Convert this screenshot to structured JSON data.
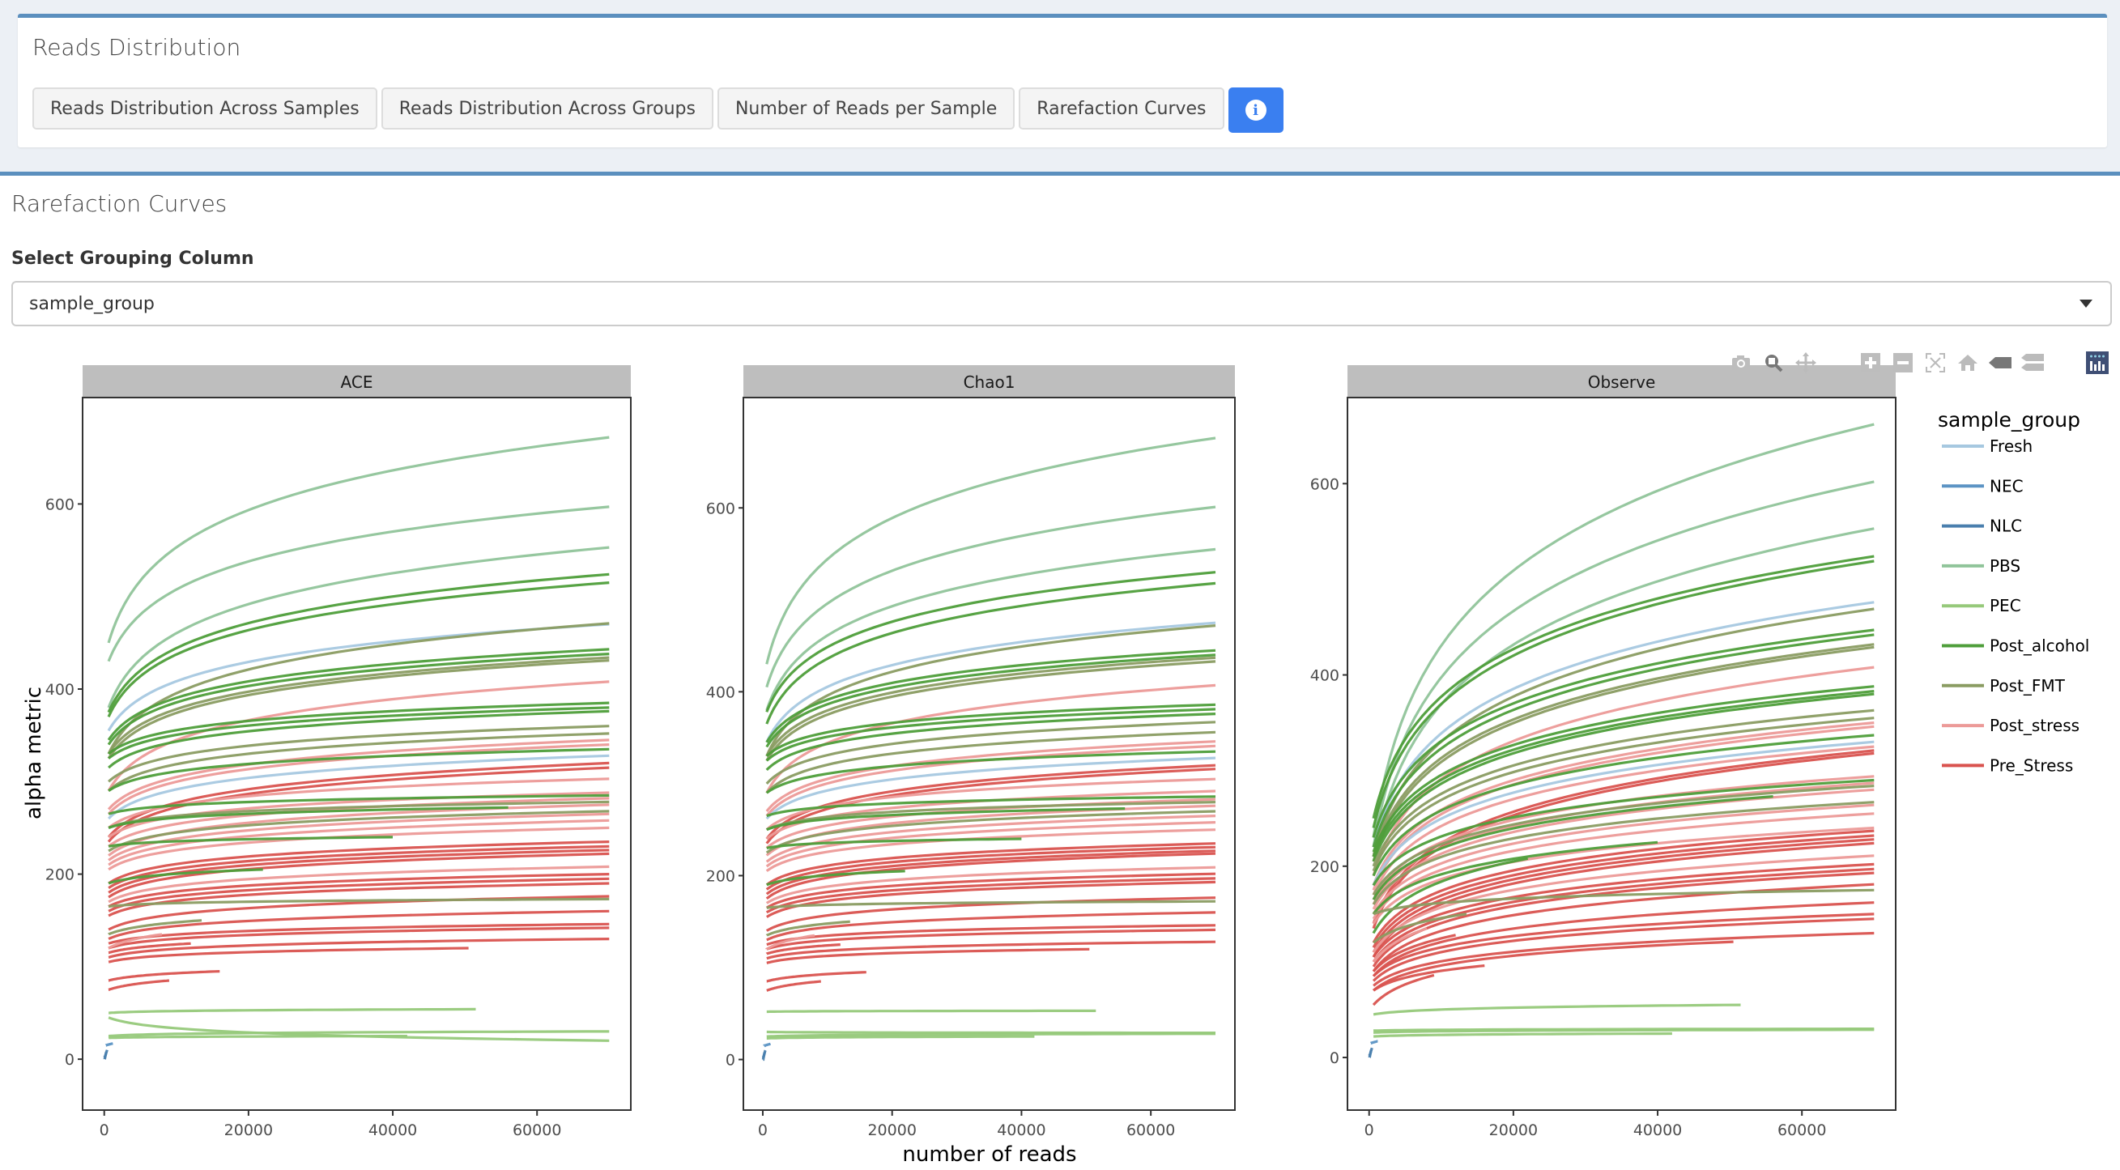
{
  "top": {
    "title": "Reads Distribution",
    "buttons": [
      {
        "label": "Reads Distribution Across Samples"
      },
      {
        "label": "Reads Distribution Across Groups"
      },
      {
        "label": "Number of Reads per Sample"
      },
      {
        "label": "Rarefaction Curves"
      }
    ],
    "info_icon": "info-circle-icon",
    "info_color": "#3a7ff0"
  },
  "main": {
    "title": "Rarefaction Curves",
    "select_label": "Select Grouping Column",
    "select_value": "sample_group"
  },
  "modebar": [
    "camera-icon",
    "zoom-icon",
    "pan-icon",
    "zoom-in-icon",
    "zoom-out-icon",
    "autoscale-icon",
    "home-icon",
    "hover-closest-icon",
    "hover-compare-icon",
    "plotly-logo-icon"
  ],
  "chart_data": {
    "type": "line",
    "facets": [
      "ACE",
      "Chao1",
      "Observe"
    ],
    "xlabel": "number of reads",
    "ylabel": "alpha metric",
    "x_ticks": [
      0,
      20000,
      40000,
      60000
    ],
    "y_ticks": [
      0,
      200,
      400,
      600
    ],
    "xlim": [
      -3000,
      73000
    ],
    "legend_title": "sample_group",
    "legend_position": "right",
    "groups": [
      {
        "name": "Fresh",
        "color": "#a6c8e0"
      },
      {
        "name": "NEC",
        "color": "#5b93c4"
      },
      {
        "name": "NLC",
        "color": "#4a7fae"
      },
      {
        "name": "PBS",
        "color": "#90c49a"
      },
      {
        "name": "PEC",
        "color": "#96c97a"
      },
      {
        "name": "Post_alcohol",
        "color": "#4e9e3a"
      },
      {
        "name": "Post_FMT",
        "color": "#8a9c62"
      },
      {
        "name": "Post_stress",
        "color": "#ec9a98"
      },
      {
        "name": "Pre_Stress",
        "color": "#d9534f"
      }
    ],
    "panels": [
      {
        "name": "ACE",
        "ylim": [
          -55,
          715
        ]
      },
      {
        "name": "Chao1",
        "ylim": [
          -55,
          720
        ]
      },
      {
        "name": "Observe",
        "ylim": [
          -55,
          690
        ]
      }
    ],
    "samples": [
      {
        "group": "PBS",
        "xmax": 70000,
        "ACE": [
          450,
          672
        ],
        "Chao1": [
          430,
          676
        ],
        "Observe": [
          230,
          662
        ]
      },
      {
        "group": "PBS",
        "xmax": 70000,
        "ACE": [
          430,
          597
        ],
        "Chao1": [
          405,
          601
        ],
        "Observe": [
          220,
          602
        ]
      },
      {
        "group": "PBS",
        "xmax": 70000,
        "ACE": [
          380,
          553
        ],
        "Chao1": [
          380,
          555
        ],
        "Observe": [
          210,
          553
        ]
      },
      {
        "group": "Post_alcohol",
        "xmax": 70000,
        "ACE": [
          375,
          524
        ],
        "Chao1": [
          378,
          530
        ],
        "Observe": [
          250,
          524
        ]
      },
      {
        "group": "Post_alcohol",
        "xmax": 70000,
        "ACE": [
          370,
          515
        ],
        "Chao1": [
          365,
          518
        ],
        "Observe": [
          240,
          519
        ]
      },
      {
        "group": "Fresh",
        "xmax": 70000,
        "ACE": [
          355,
          470
        ],
        "Chao1": [
          345,
          475
        ],
        "Observe": [
          220,
          476
        ]
      },
      {
        "group": "Post_FMT",
        "xmax": 70000,
        "ACE": [
          330,
          471
        ],
        "Chao1": [
          330,
          472
        ],
        "Observe": [
          210,
          469
        ]
      },
      {
        "group": "Post_alcohol",
        "xmax": 70000,
        "ACE": [
          345,
          443
        ],
        "Chao1": [
          345,
          445
        ],
        "Observe": [
          230,
          447
        ]
      },
      {
        "group": "Post_alcohol",
        "xmax": 70000,
        "ACE": [
          340,
          438
        ],
        "Chao1": [
          340,
          440
        ],
        "Observe": [
          220,
          442
        ]
      },
      {
        "group": "Post_FMT",
        "xmax": 70000,
        "ACE": [
          330,
          434
        ],
        "Chao1": [
          330,
          437
        ],
        "Observe": [
          210,
          432
        ]
      },
      {
        "group": "Post_FMT",
        "xmax": 70000,
        "ACE": [
          325,
          431
        ],
        "Chao1": [
          325,
          433
        ],
        "Observe": [
          205,
          429
        ]
      },
      {
        "group": "Post_stress",
        "xmax": 70000,
        "ACE": [
          290,
          408
        ],
        "Chao1": [
          290,
          407
        ],
        "Observe": [
          190,
          408
        ]
      },
      {
        "group": "Post_alcohol",
        "xmax": 70000,
        "ACE": [
          330,
          385
        ],
        "Chao1": [
          330,
          386
        ],
        "Observe": [
          215,
          388
        ]
      },
      {
        "group": "Post_alcohol",
        "xmax": 70000,
        "ACE": [
          325,
          380
        ],
        "Chao1": [
          325,
          381
        ],
        "Observe": [
          210,
          383
        ]
      },
      {
        "group": "Post_alcohol",
        "xmax": 70000,
        "ACE": [
          315,
          376
        ],
        "Chao1": [
          315,
          376
        ],
        "Observe": [
          205,
          380
        ]
      },
      {
        "group": "Post_FMT",
        "xmax": 70000,
        "ACE": [
          300,
          360
        ],
        "Chao1": [
          300,
          367
        ],
        "Observe": [
          200,
          363
        ]
      },
      {
        "group": "Post_FMT",
        "xmax": 70000,
        "ACE": [
          290,
          352
        ],
        "Chao1": [
          290,
          356
        ],
        "Observe": [
          195,
          355
        ]
      },
      {
        "group": "Post_stress",
        "xmax": 70000,
        "ACE": [
          270,
          345
        ],
        "Chao1": [
          270,
          346
        ],
        "Observe": [
          180,
          350
        ]
      },
      {
        "group": "Post_stress",
        "xmax": 70000,
        "ACE": [
          265,
          340
        ],
        "Chao1": [
          265,
          341
        ],
        "Observe": [
          175,
          346
        ]
      },
      {
        "group": "Post_alcohol",
        "xmax": 70000,
        "ACE": [
          290,
          335
        ],
        "Chao1": [
          290,
          335
        ],
        "Observe": [
          190,
          337
        ]
      },
      {
        "group": "Fresh",
        "xmax": 70000,
        "ACE": [
          260,
          328
        ],
        "Chao1": [
          262,
          328
        ],
        "Observe": [
          180,
          330
        ]
      },
      {
        "group": "Pre_Stress",
        "xmax": 70000,
        "ACE": [
          240,
          320
        ],
        "Chao1": [
          240,
          320
        ],
        "Observe": [
          140,
          321
        ]
      },
      {
        "group": "Pre_Stress",
        "xmax": 70000,
        "ACE": [
          235,
          315
        ],
        "Chao1": [
          235,
          316
        ],
        "Observe": [
          135,
          318
        ]
      },
      {
        "group": "Post_stress",
        "xmax": 70000,
        "ACE": [
          250,
          303
        ],
        "Chao1": [
          250,
          305
        ],
        "Observe": [
          170,
          325
        ]
      },
      {
        "group": "Post_stress",
        "xmax": 70000,
        "ACE": [
          240,
          288
        ],
        "Chao1": [
          240,
          292
        ],
        "Observe": [
          165,
          294
        ]
      },
      {
        "group": "Post_alcohol",
        "xmax": 70000,
        "ACE": [
          265,
          285
        ],
        "Chao1": [
          265,
          286
        ],
        "Observe": [
          180,
          290
        ]
      },
      {
        "group": "Post_stress",
        "xmax": 70000,
        "ACE": [
          230,
          282
        ],
        "Chao1": [
          230,
          283
        ],
        "Observe": [
          160,
          287
        ]
      },
      {
        "group": "Post_FMT",
        "xmax": 70000,
        "ACE": [
          250,
          278
        ],
        "Chao1": [
          250,
          280
        ],
        "Observe": [
          170,
          284
        ]
      },
      {
        "group": "Post_stress",
        "xmax": 70000,
        "ACE": [
          220,
          275
        ],
        "Chao1": [
          222,
          276
        ],
        "Observe": [
          155,
          280
        ]
      },
      {
        "group": "Post_alcohol",
        "xmax": 56000,
        "ACE": [
          250,
          272
        ],
        "Chao1": [
          250,
          273
        ],
        "Observe": [
          165,
          273
        ]
      },
      {
        "group": "Post_FMT",
        "xmax": 70000,
        "ACE": [
          225,
          268
        ],
        "Chao1": [
          225,
          270
        ],
        "Observe": [
          160,
          267
        ]
      },
      {
        "group": "Post_stress",
        "xmax": 70000,
        "ACE": [
          215,
          265
        ],
        "Chao1": [
          215,
          265
        ],
        "Observe": [
          150,
          264
        ]
      },
      {
        "group": "Post_stress",
        "xmax": 70000,
        "ACE": [
          210,
          258
        ],
        "Chao1": [
          210,
          258
        ],
        "Observe": [
          145,
          255
        ]
      },
      {
        "group": "Post_stress",
        "xmax": 70000,
        "ACE": [
          205,
          250
        ],
        "Chao1": [
          205,
          250
        ],
        "Observe": [
          140,
          240
        ]
      },
      {
        "group": "Post_alcohol",
        "xmax": 40000,
        "ACE": [
          230,
          240
        ],
        "Chao1": [
          230,
          240
        ],
        "Observe": [
          150,
          225
        ]
      },
      {
        "group": "Pre_Stress",
        "xmax": 70000,
        "ACE": [
          190,
          235
        ],
        "Chao1": [
          190,
          235
        ],
        "Observe": [
          120,
          237
        ]
      },
      {
        "group": "Pre_Stress",
        "xmax": 70000,
        "ACE": [
          185,
          230
        ],
        "Chao1": [
          185,
          231
        ],
        "Observe": [
          115,
          232
        ]
      },
      {
        "group": "Pre_Stress",
        "xmax": 70000,
        "ACE": [
          180,
          226
        ],
        "Chao1": [
          180,
          227
        ],
        "Observe": [
          110,
          228
        ]
      },
      {
        "group": "Pre_Stress",
        "xmax": 70000,
        "ACE": [
          175,
          222
        ],
        "Chao1": [
          175,
          224
        ],
        "Observe": [
          105,
          224
        ]
      },
      {
        "group": "Post_alcohol",
        "xmax": 22000,
        "ACE": [
          190,
          205
        ],
        "Chao1": [
          190,
          205
        ],
        "Observe": [
          130,
          208
        ]
      },
      {
        "group": "Post_stress",
        "xmax": 70000,
        "ACE": [
          170,
          208
        ],
        "Chao1": [
          170,
          209
        ],
        "Observe": [
          110,
          211
        ]
      },
      {
        "group": "Pre_Stress",
        "xmax": 70000,
        "ACE": [
          165,
          200
        ],
        "Chao1": [
          165,
          202
        ],
        "Observe": [
          105,
          202
        ]
      },
      {
        "group": "Pre_Stress",
        "xmax": 70000,
        "ACE": [
          160,
          195
        ],
        "Chao1": [
          160,
          197
        ],
        "Observe": [
          100,
          197
        ]
      },
      {
        "group": "Pre_Stress",
        "xmax": 70000,
        "ACE": [
          155,
          190
        ],
        "Chao1": [
          155,
          193
        ],
        "Observe": [
          95,
          193
        ]
      },
      {
        "group": "Pre_Stress",
        "xmax": 70000,
        "ACE": [
          140,
          176
        ],
        "Chao1": [
          140,
          176
        ],
        "Observe": [
          90,
          181
        ]
      },
      {
        "group": "Post_FMT",
        "xmax": 70000,
        "ACE": [
          165,
          173
        ],
        "Chao1": [
          165,
          172
        ],
        "Observe": [
          150,
          175
        ]
      },
      {
        "group": "Pre_Stress",
        "xmax": 70000,
        "ACE": [
          130,
          160
        ],
        "Chao1": [
          130,
          160
        ],
        "Observe": [
          85,
          162
        ]
      },
      {
        "group": "Post_FMT",
        "xmax": 13500,
        "ACE": [
          135,
          150
        ],
        "Chao1": [
          135,
          150
        ],
        "Observe": [
          120,
          150
        ]
      },
      {
        "group": "Pre_Stress",
        "xmax": 70000,
        "ACE": [
          125,
          146
        ],
        "Chao1": [
          125,
          146
        ],
        "Observe": [
          85,
          150
        ]
      },
      {
        "group": "Pre_Stress",
        "xmax": 70000,
        "ACE": [
          120,
          142
        ],
        "Chao1": [
          120,
          141
        ],
        "Observe": [
          80,
          145
        ]
      },
      {
        "group": "Post_stress",
        "xmax": 8000,
        "ACE": [
          120,
          135
        ],
        "Chao1": [
          120,
          135
        ],
        "Observe": [
          100,
          135
        ]
      },
      {
        "group": "Pre_Stress",
        "xmax": 12000,
        "ACE": [
          115,
          125
        ],
        "Chao1": [
          115,
          125
        ],
        "Observe": [
          90,
          128
        ]
      },
      {
        "group": "Pre_Stress",
        "xmax": 70000,
        "ACE": [
          110,
          130
        ],
        "Chao1": [
          110,
          128
        ],
        "Observe": [
          75,
          130
        ]
      },
      {
        "group": "Pre_Stress",
        "xmax": 50500,
        "ACE": [
          105,
          120
        ],
        "Chao1": [
          105,
          120
        ],
        "Observe": [
          70,
          121
        ]
      },
      {
        "group": "Pre_Stress",
        "xmax": 16000,
        "ACE": [
          85,
          95
        ],
        "Chao1": [
          85,
          95
        ],
        "Observe": [
          70,
          96
        ]
      },
      {
        "group": "Pre_Stress",
        "xmax": 9000,
        "ACE": [
          75,
          85
        ],
        "Chao1": [
          75,
          85
        ],
        "Observe": [
          55,
          86
        ]
      },
      {
        "group": "PEC",
        "xmax": 51500,
        "ACE": [
          50,
          54
        ],
        "Chao1": [
          52,
          53
        ],
        "Observe": [
          45,
          55
        ]
      },
      {
        "group": "PEC",
        "xmax": 70000,
        "ACE": [
          45,
          20
        ],
        "Chao1": [
          30,
          29
        ],
        "Observe": [
          28,
          30
        ]
      },
      {
        "group": "PEC",
        "xmax": 70000,
        "ACE": [
          25,
          30
        ],
        "Chao1": [
          25,
          28
        ],
        "Observe": [
          26,
          29
        ]
      },
      {
        "group": "PEC",
        "xmax": 42000,
        "ACE": [
          23,
          25
        ],
        "Chao1": [
          23,
          25
        ],
        "Observe": [
          22,
          25
        ]
      },
      {
        "group": "NEC",
        "xmax": 1200,
        "ACE": [
          15,
          17
        ],
        "Chao1": [
          15,
          17
        ],
        "Observe": [
          15,
          17
        ]
      },
      {
        "group": "NLC",
        "xmax": 400,
        "ACE": [
          2,
          10
        ],
        "Chao1": [
          2,
          10
        ],
        "Observe": [
          2,
          10
        ]
      },
      {
        "group": "NLC",
        "xmax": 300,
        "ACE": [
          0,
          8
        ],
        "Chao1": [
          0,
          8
        ],
        "Observe": [
          0,
          8
        ]
      }
    ]
  }
}
